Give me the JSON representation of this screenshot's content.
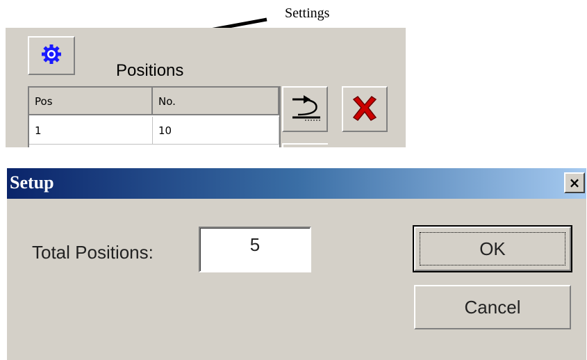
{
  "annotation": {
    "text": "Settings"
  },
  "main_window": {
    "settings_icon": "gear-icon",
    "title": "Positions",
    "table": {
      "headers": [
        "Pos",
        "No."
      ],
      "rows": [
        [
          "1",
          "10"
        ]
      ]
    },
    "undo_icon": "undo-icon",
    "delete_icon": "red-x-icon",
    "colors": {
      "gear": "#1a1aff",
      "red_x": "#cc0000"
    }
  },
  "setup_dialog": {
    "title": "Setup",
    "close_label": "×",
    "total_positions_label": "Total Positions:",
    "total_positions_value": "5",
    "ok_label": "OK",
    "cancel_label": "Cancel",
    "colors": {
      "titlebar_start": "#0a246a",
      "titlebar_end": "#a6caf0"
    }
  }
}
